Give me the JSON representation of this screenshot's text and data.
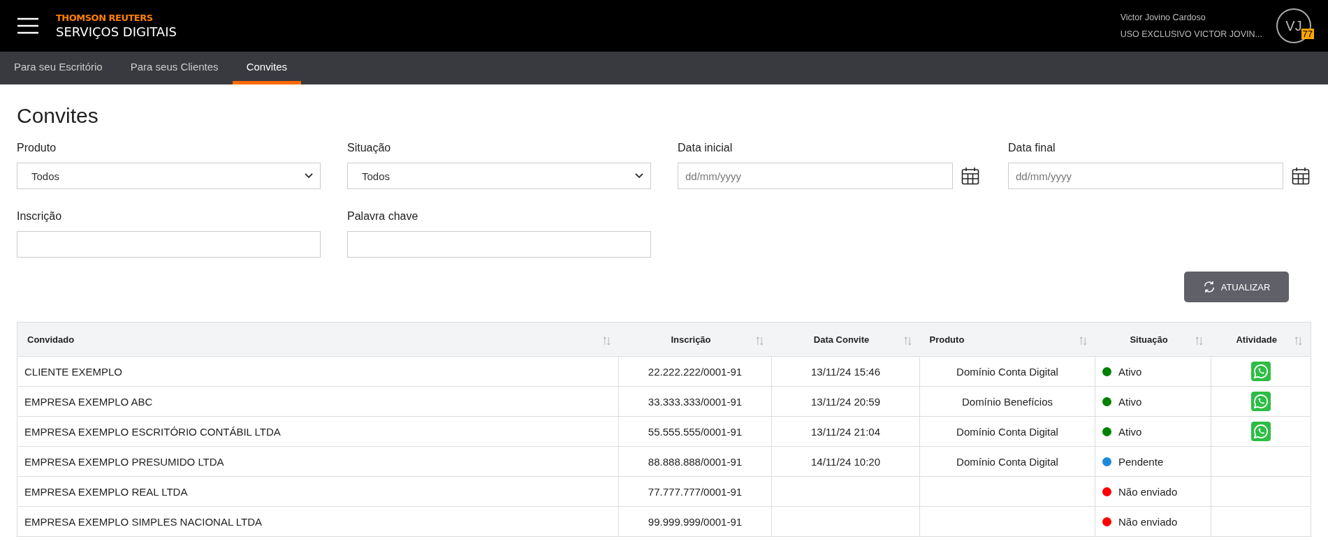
{
  "header": {
    "brand": "THOMSON REUTERS",
    "product": "SERVIÇOS DIGITAIS",
    "user_name": "Victor Jovino Cardoso",
    "user_account": "USO EXCLUSIVO VICTOR JOVIN...",
    "avatar_initials": "VJ",
    "badge": "77"
  },
  "tabs": [
    {
      "label": "Para seu Escritório",
      "selected": false
    },
    {
      "label": "Para seus Clientes",
      "selected": false
    },
    {
      "label": "Convites",
      "selected": true
    }
  ],
  "page_title": "Convites",
  "filters": [
    {
      "label": "Produto",
      "kind": "select",
      "value": "Todos"
    },
    {
      "label": "Situação",
      "kind": "select",
      "value": "Todos"
    },
    {
      "label": "Data inicial",
      "kind": "date",
      "placeholder": "dd/mm/yyyy"
    },
    {
      "label": "Data final",
      "kind": "date",
      "placeholder": "dd/mm/yyyy"
    },
    {
      "label": "Inscrição",
      "kind": "text"
    },
    {
      "label": "Palavra chave",
      "kind": "text"
    }
  ],
  "refresh_button": "ATUALIZAR",
  "table": {
    "columns": [
      "Convidado",
      "Inscrição",
      "Data Convite",
      "Produto",
      "Situação",
      "Atividade"
    ],
    "rows": [
      {
        "name": "CLIENTE EXEMPLO",
        "inscricao": "22.222.222/0001-91",
        "date": "13/11/24 15:46",
        "product": "Domínio Conta Digital",
        "status": "Ativo",
        "color": "#008000",
        "whatsapp": true
      },
      {
        "name": "EMPRESA EXEMPLO ABC",
        "inscricao": "33.333.333/0001-91",
        "date": "13/11/24 20:59",
        "product": "Domínio Benefícios",
        "status": "Ativo",
        "color": "#008000",
        "whatsapp": true
      },
      {
        "name": "EMPRESA EXEMPLO ESCRITÓRIO CONTÁBIL LTDA",
        "inscricao": "55.555.555/0001-91",
        "date": "13/11/24 21:04",
        "product": "Domínio Conta Digital",
        "status": "Ativo",
        "color": "#008000",
        "whatsapp": true
      },
      {
        "name": "EMPRESA EXEMPLO PRESUMIDO LTDA",
        "inscricao": "88.888.888/0001-91",
        "date": "14/11/24 10:20",
        "product": "Domínio Conta Digital",
        "status": "Pendente",
        "color": "#1e88d8",
        "whatsapp": false
      },
      {
        "name": "EMPRESA EXEMPLO REAL LTDA",
        "inscricao": "77.777.777/0001-91",
        "status": "Não enviado",
        "color": "#ff0000",
        "whatsapp": false
      },
      {
        "name": "EMPRESA EXEMPLO SIMPLES NACIONAL LTDA",
        "inscricao": "99.999.999/0001-91",
        "status": "Não enviado",
        "color": "#ff0000",
        "whatsapp": false
      }
    ]
  }
}
